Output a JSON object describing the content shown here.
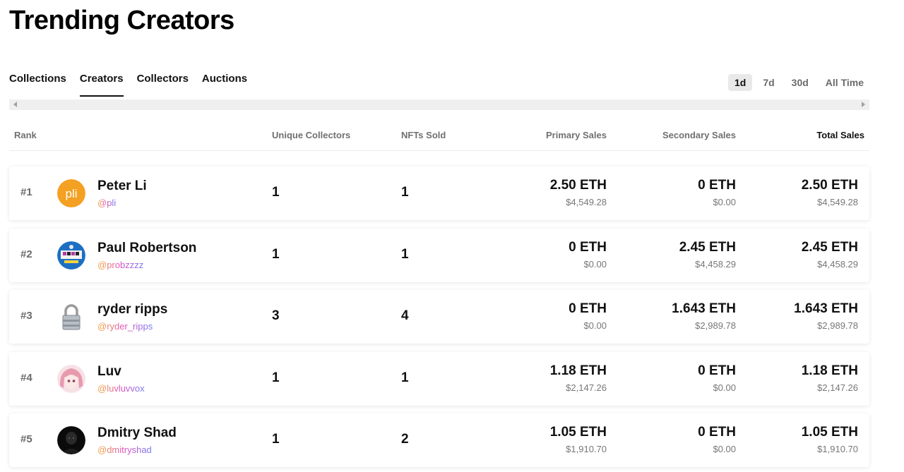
{
  "page_title": "Trending Creators",
  "tabs": [
    {
      "label": "Collections",
      "active": false
    },
    {
      "label": "Creators",
      "active": true
    },
    {
      "label": "Collectors",
      "active": false
    },
    {
      "label": "Auctions",
      "active": false
    }
  ],
  "periods": [
    {
      "label": "1d",
      "active": true
    },
    {
      "label": "7d",
      "active": false
    },
    {
      "label": "30d",
      "active": false
    },
    {
      "label": "All Time",
      "active": false
    }
  ],
  "columns": {
    "rank": "Rank",
    "unique_collectors": "Unique Collectors",
    "nfts_sold": "NFTs Sold",
    "primary_sales": "Primary Sales",
    "secondary_sales": "Secondary Sales",
    "total_sales": "Total Sales"
  },
  "rows": [
    {
      "rank": "#1",
      "name": "Peter Li",
      "handle": "@pli",
      "avatar": "pli-logo-avatar",
      "unique_collectors": "1",
      "nfts_sold": "1",
      "primary_eth": "2.50 ETH",
      "primary_usd": "$4,549.28",
      "secondary_eth": "0 ETH",
      "secondary_usd": "$0.00",
      "total_eth": "2.50 ETH",
      "total_usd": "$4,549.28"
    },
    {
      "rank": "#2",
      "name": "Paul Robertson",
      "handle": "@probzzzz",
      "avatar": "pixel-art-avatar",
      "unique_collectors": "1",
      "nfts_sold": "1",
      "primary_eth": "0 ETH",
      "primary_usd": "$0.00",
      "secondary_eth": "2.45 ETH",
      "secondary_usd": "$4,458.29",
      "total_eth": "2.45 ETH",
      "total_usd": "$4,458.29"
    },
    {
      "rank": "#3",
      "name": "ryder ripps",
      "handle": "@ryder_ripps",
      "avatar": "padlock-avatar",
      "unique_collectors": "3",
      "nfts_sold": "4",
      "primary_eth": "0 ETH",
      "primary_usd": "$0.00",
      "secondary_eth": "1.643 ETH",
      "secondary_usd": "$2,989.78",
      "total_eth": "1.643 ETH",
      "total_usd": "$2,989.78"
    },
    {
      "rank": "#4",
      "name": "Luv",
      "handle": "@luvluvvox",
      "avatar": "anime-pink-hair-avatar",
      "unique_collectors": "1",
      "nfts_sold": "1",
      "primary_eth": "1.18 ETH",
      "primary_usd": "$2,147.26",
      "secondary_eth": "0 ETH",
      "secondary_usd": "$0.00",
      "total_eth": "1.18 ETH",
      "total_usd": "$2,147.26"
    },
    {
      "rank": "#5",
      "name": "Dmitry Shad",
      "handle": "@dmitryshad",
      "avatar": "dark-portrait-avatar",
      "unique_collectors": "1",
      "nfts_sold": "2",
      "primary_eth": "1.05 ETH",
      "primary_usd": "$1,910.70",
      "secondary_eth": "0 ETH",
      "secondary_usd": "$0.00",
      "total_eth": "1.05 ETH",
      "total_usd": "$1,910.70"
    }
  ],
  "colors": {
    "accent": "#111111",
    "muted": "#707070",
    "pli_orange": "#f4a022"
  }
}
